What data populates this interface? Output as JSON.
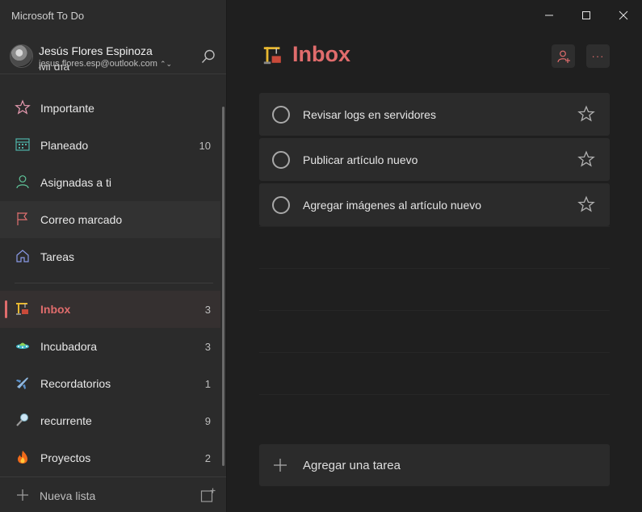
{
  "window": {
    "title": "Microsoft To Do"
  },
  "account": {
    "name": "Jesús Flores Espinoza",
    "email": "jesus.flores.esp@outlook.com"
  },
  "sidebar": {
    "cut_item": "Mi día",
    "smart_lists": [
      {
        "label": "Importante",
        "count": "",
        "icon": "star-icon"
      },
      {
        "label": "Planeado",
        "count": "10",
        "icon": "calendar-icon"
      },
      {
        "label": "Asignadas a ti",
        "count": "",
        "icon": "person-icon"
      },
      {
        "label": "Correo marcado",
        "count": "",
        "icon": "flag-icon"
      },
      {
        "label": "Tareas",
        "count": "",
        "icon": "home-icon"
      }
    ],
    "lists": [
      {
        "label": "Inbox",
        "count": "3",
        "icon": "construction-crane-icon"
      },
      {
        "label": "Incubadora",
        "count": "3",
        "icon": "ufo-icon"
      },
      {
        "label": "Recordatorios",
        "count": "1",
        "icon": "airplane-icon"
      },
      {
        "label": "recurrente",
        "count": "9",
        "icon": "magnifier-icon"
      },
      {
        "label": "Proyectos",
        "count": "2",
        "icon": "fire-icon"
      }
    ],
    "new_list_label": "Nueva lista"
  },
  "main": {
    "title": "Inbox",
    "tasks": [
      {
        "text": "Revisar logs en servidores"
      },
      {
        "text": "Publicar artículo nuevo"
      },
      {
        "text": "Agregar imágenes al artículo nuevo"
      }
    ],
    "add_task_label": "Agregar una tarea",
    "more_label": "···"
  },
  "colors": {
    "accent": "#e06c6c",
    "sidebar_bg": "#2b2b2b",
    "main_bg": "#1f1f1f",
    "task_bg": "#2b2b2b"
  }
}
